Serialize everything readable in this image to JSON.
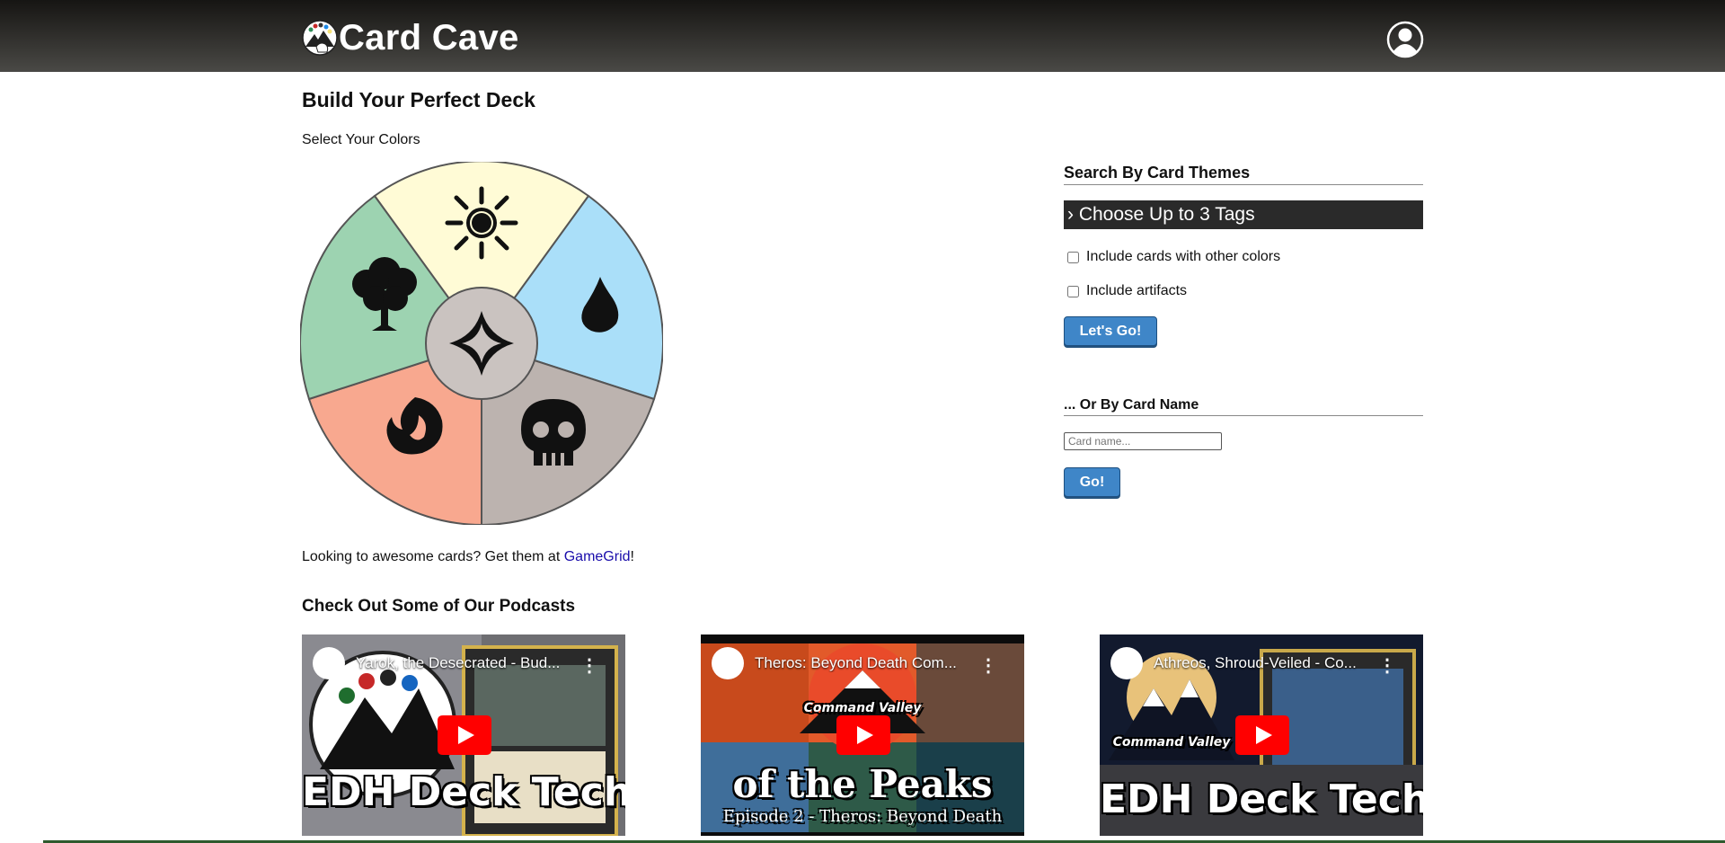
{
  "app": {
    "title": "Card Cave"
  },
  "header": {
    "profile_icon": "user-circle-icon"
  },
  "builder": {
    "title": "Build Your Perfect Deck",
    "subtitle": "Select Your Colors",
    "wheel": {
      "center_icon": "colorless-diamond-icon",
      "slices": [
        {
          "color": "white",
          "icon": "sun-icon",
          "fill": "#fffbd6"
        },
        {
          "color": "blue",
          "icon": "water-drop-icon",
          "fill": "#aadff9"
        },
        {
          "color": "black",
          "icon": "skull-icon",
          "fill": "#bcb3af"
        },
        {
          "color": "red",
          "icon": "flame-icon",
          "fill": "#f8a88f"
        },
        {
          "color": "green",
          "icon": "tree-icon",
          "fill": "#9dd3b1"
        }
      ],
      "center_fill": "#cac3c0"
    },
    "promo_text": "Looking to awesome cards? Get them at ",
    "promo_link": "GameGrid",
    "promo_suffix": "!"
  },
  "themes": {
    "title": "Search By Card Themes",
    "tags_button": "› Choose Up to 3 Tags",
    "checkbox_other_colors": "Include cards with other colors",
    "checkbox_artifacts": "Include artifacts",
    "submit": "Let's Go!"
  },
  "by_name": {
    "title": "... Or By Card Name",
    "placeholder": "Card name...",
    "submit": "Go!"
  },
  "podcasts": {
    "title": "Check Out Some of Our Podcasts",
    "videos": [
      {
        "title": "Yarok, the Desecrated - Bud...",
        "big_text": "EDH Deck Tech"
      },
      {
        "title": "Theros: Beyond Death Com...",
        "big_text": "of the Peaks",
        "small_top": "Command Valley",
        "small_bottom": "Episode 2 - Theros: Beyond Death"
      },
      {
        "title": "Athreos, Shroud-Veiled - Co...",
        "big_text": "EDH Deck Tech",
        "small_top": "Command Valley"
      }
    ]
  },
  "colors": {
    "accent": "#3f86c8",
    "header": "#2b2a28",
    "link": "#1a0dab"
  }
}
